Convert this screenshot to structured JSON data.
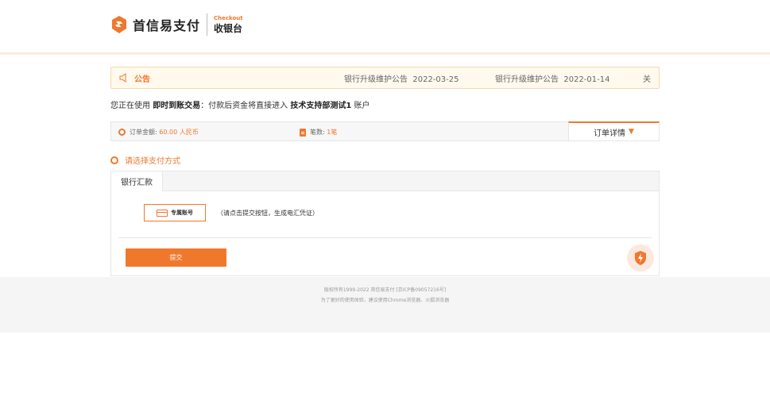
{
  "header": {
    "brand_name": "首信易支付",
    "checkout_en": "Checkout",
    "checkout_cn": "收银台",
    "brand_color": "#f0782d"
  },
  "notice": {
    "title": "公告",
    "items": [
      {
        "text": "银行升级维护公告",
        "date": "2022-03-25"
      },
      {
        "text": "银行升级维护公告",
        "date": "2022-01-14"
      }
    ],
    "close_label": "关"
  },
  "using": {
    "prefix": "您正在使用",
    "mode": "即时到账交易",
    "middle": "：付款后资金将直接进入",
    "merchant": "技术支持部测试1",
    "suffix": "账户"
  },
  "order": {
    "amount_label": "订单金额:",
    "amount_value": "60.00 人民币",
    "count_label": "笔数:",
    "count_value": "1笔",
    "detail_label": "订单详情",
    "detail_caret": "▼"
  },
  "payment": {
    "choose_label": "请选择支付方式",
    "tabs": [
      {
        "label": "银行汇款"
      }
    ],
    "method_label": "专属账号",
    "hint": "（请点击提交按钮，生成电汇凭证）",
    "submit_label": "提交"
  },
  "footer": {
    "copyright": "版权所有1999-2022 首信易支付 [京ICP备09057216号]",
    "browser_tip": "为了更好的使用体验，建议使用Chrome浏览器、火狐浏览器"
  }
}
